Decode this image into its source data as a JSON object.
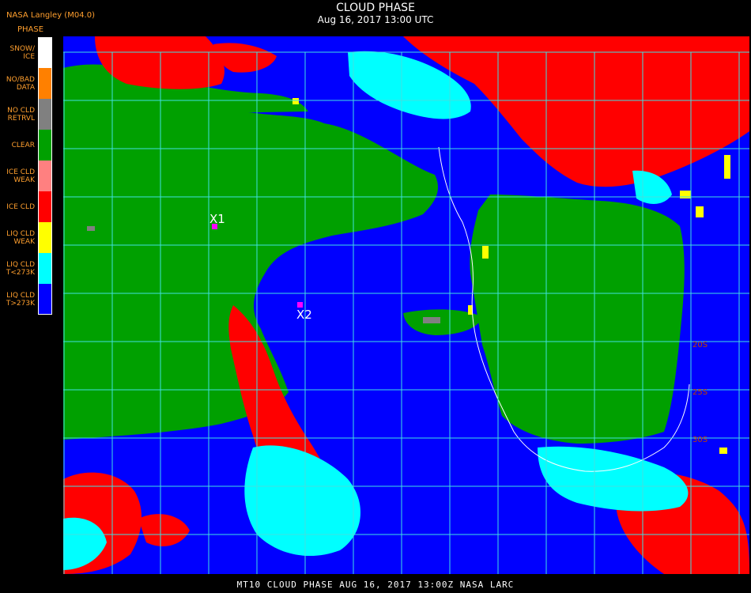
{
  "header": {
    "provider": "NASA Langley (M04.0)",
    "title": "CLOUD PHASE",
    "datetime": "Aug 16, 2017 13:00 UTC"
  },
  "legend": {
    "title": "PHASE",
    "items": [
      {
        "label": "SNOW/\nICE",
        "color": "#ffffff"
      },
      {
        "label": "NO/BAD\nDATA",
        "color": "#ff8000"
      },
      {
        "label": "NO CLD\nRETRVL",
        "color": "#808080"
      },
      {
        "label": "CLEAR",
        "color": "#00a000"
      },
      {
        "label": "ICE CLD\nWEAK",
        "color": "#ff8080"
      },
      {
        "label": "ICE CLD",
        "color": "#ff0000"
      },
      {
        "label": "LIQ CLD\nWEAK",
        "color": "#ffff00"
      },
      {
        "label": "LIQ CLD\nT<273K",
        "color": "#00ffff"
      },
      {
        "label": "LIQ CLD\nT>273K",
        "color": "#0000ff"
      }
    ]
  },
  "markers": [
    {
      "label": "X1"
    },
    {
      "label": "X2"
    }
  ],
  "lat_labels": [
    "20S",
    "25S",
    "30S"
  ],
  "colors": {
    "grid": "#40e0e0",
    "lat_label": "#c04000",
    "marker": "#ff00ff"
  },
  "footer": "MT10  CLOUD PHASE   AUG 16, 2017 13:00Z   NASA LARC"
}
